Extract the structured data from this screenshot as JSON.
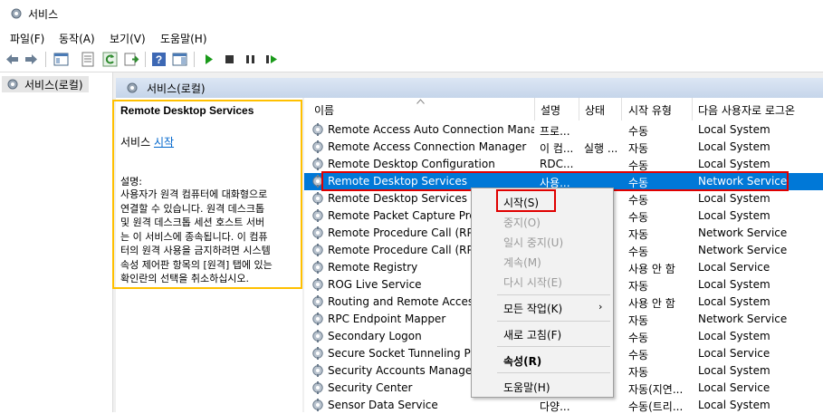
{
  "window": {
    "title": "서비스"
  },
  "menu": [
    "파일(F)",
    "동작(A)",
    "보기(V)",
    "도움말(H)"
  ],
  "tree": {
    "selected": "서비스(로컬)"
  },
  "header": {
    "title": "서비스(로컬)"
  },
  "description": {
    "service_name": "Remote Desktop Services",
    "service_prefix": "서비스",
    "start_link": "시작",
    "label": "설명:",
    "lines": [
      "사용자가 원격 컴퓨터에 대화형으로",
      "연결할 수 있습니다. 원격 데스크톱",
      "및 원격 데스크톱 세션 호스트 서버",
      "는 이 서비스에 종속됩니다. 이 컴퓨",
      "터의 원격 사용을 금지하려면 시스템",
      "속성 제어판 항목의 [원격] 탭에 있는",
      "확인란의 선택을 취소하십시오."
    ]
  },
  "columns": {
    "name": "이름",
    "desc": "설명",
    "status": "상태",
    "startup": "시작 유형",
    "logon": "다음 사용자로 로그온"
  },
  "rows": [
    {
      "name": "Remote Access Auto Connection Mana...",
      "desc": "프로...",
      "status": "",
      "startup": "수동",
      "logon": "Local System"
    },
    {
      "name": "Remote Access Connection Manager",
      "desc": "이 컴...",
      "status": "실행 ...",
      "startup": "자동",
      "logon": "Local System"
    },
    {
      "name": "Remote Desktop Configuration",
      "desc": "RDC...",
      "status": "",
      "startup": "수동",
      "logon": "Local System"
    },
    {
      "name": "Remote Desktop Services",
      "desc": "사용...",
      "status": "",
      "startup": "수동",
      "logon": "Network Service"
    },
    {
      "name": "Remote Desktop Services Use",
      "desc": "",
      "status": "",
      "startup": "수동",
      "logon": "Local System"
    },
    {
      "name": "Remote Packet Capture Proto",
      "desc": "",
      "status": "",
      "startup": "수동",
      "logon": "Local System"
    },
    {
      "name": "Remote Procedure Call (RPC)",
      "desc": "",
      "status": "",
      "startup": "자동",
      "logon": "Network Service"
    },
    {
      "name": "Remote Procedure Call (RPC)",
      "desc": "",
      "status": "",
      "startup": "수동",
      "logon": "Network Service"
    },
    {
      "name": "Remote Registry",
      "desc": "",
      "status": "",
      "startup": "사용 안 함",
      "logon": "Local Service"
    },
    {
      "name": "ROG Live Service",
      "desc": "",
      "status": "",
      "startup": "자동",
      "logon": "Local System"
    },
    {
      "name": "Routing and Remote Access",
      "desc": "",
      "status": "",
      "startup": "사용 안 함",
      "logon": "Local System"
    },
    {
      "name": "RPC Endpoint Mapper",
      "desc": "",
      "status": "",
      "startup": "자동",
      "logon": "Network Service"
    },
    {
      "name": "Secondary Logon",
      "desc": "",
      "status": "",
      "startup": "수동",
      "logon": "Local System"
    },
    {
      "name": "Secure Socket Tunneling Prot",
      "desc": "",
      "status": "",
      "startup": "수동",
      "logon": "Local Service"
    },
    {
      "name": "Security Accounts Manager",
      "desc": "",
      "status": "",
      "startup": "자동",
      "logon": "Local System"
    },
    {
      "name": "Security Center",
      "desc": "",
      "status": "",
      "startup": "자동(지연...",
      "logon": "Local Service"
    },
    {
      "name": "Sensor Data Service",
      "desc": "다양...",
      "status": "",
      "startup": "수동(트리...",
      "logon": "Local System"
    }
  ],
  "context_menu": {
    "start": "시작(S)",
    "stop": "중지(O)",
    "pause": "일시 중지(U)",
    "resume": "계속(M)",
    "restart": "다시 시작(E)",
    "all_tasks": "모든 작업(K)",
    "refresh": "새로 고침(F)",
    "properties": "속성(R)",
    "help": "도움말(H)"
  },
  "colors": {
    "selection": "#0078d7",
    "highlight_red": "#e00000",
    "highlight_yellow": "#ffc000",
    "link": "#0066cc"
  }
}
